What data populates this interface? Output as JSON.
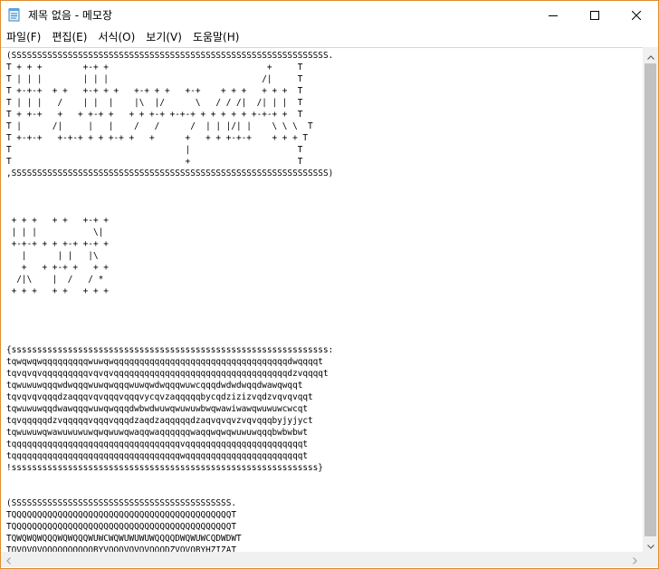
{
  "window": {
    "title": "제목 없음 - 메모장",
    "icon": "notepad-icon"
  },
  "caption_buttons": {
    "minimize": "minimize-icon",
    "maximize": "maximize-icon",
    "close": "close-icon"
  },
  "menu": [
    {
      "label": "파일(F)"
    },
    {
      "label": "편집(E)"
    },
    {
      "label": "서식(O)"
    },
    {
      "label": "보기(V)"
    },
    {
      "label": "도움말(H)"
    }
  ],
  "editor": {
    "content": "(SSSSSSSSSSSSSSSSSSSSSSSSSSSSSSSSSSSSSSSSSSSSSSSSSSSSSSSSSSSSSS.\nT + + +        +-+ +                               +     T\nT | | |        | | |                              /|     T\nT +-+-+  + +   +-+ + +   +-+ + +   +-+    + + +   + + +  T\nT | | |   /    | |  |    |\\  |/      \\   / / /|  /| | |  T\nT + +-+   +   + +-+ +   + + +-+ +-+-+ + + + + + +-+-+ +  T\nT |      /|     |   |    /   /      /  | | |/| |    \\ \\ \\  T\nT +-+-+   +-+-+ + + +-+ +   +      +   + + +-+-+    + + + T\nT                                  |                     T\nT                                  +                     T\n,SSSSSSSSSSSSSSSSSSSSSSSSSSSSSSSSSSSSSSSSSSSSSSSSSSSSSSSSSSSSSS)\n\n\n\n + + +   + +   +-+ +\n | | |           \\|\n +-+-+ + + +-+ +-+ +\n   |      | |   |\\\n   +   + +-+ +   + +\n  /|\\    |  /   / *\n + + +   + +   + + +\n\n\n\n\n{ssssssssssssssssssssssssssssssssssssssssssssssssssssssssssssss:\ntqwqwqwqqqqqqqqqwuwqwqqqqqqqqqqqqqqqqqqqqqqqqqqqqqqqqqqdwqqqqt\ntqvqvqvqqqqqqqqqvqvqvqqqqqqqqqqqqqqqqqqqqqqqqqqqqqqqqqqdzvqqqqt\ntqwuwuwqqqwdwqqqwuwqwqqqwuwqwdwqqqwuwcqqqdwdwdwqqdwawqwqqt\ntqvqvqvqqqdzaqqqvqvqqqvqqqvycqvzaqqqqqbycqdzizizvqdzvqvqvqqt\ntqwuwuwqqdwawqqqwuwqwqqqdwbwdwuwqwuwuwbwqwawiwawqwuwuwcwcqt\ntqvqqqqqdzvqqqqqvqqqvqqqdzaqdzaqqqqqdzaqvqvqvzvqvqqqbyjyjyct\ntqwuwuwqwawuwuwuwqwqwuwqwaqqwaqqqqqqwaqqwqwqwuwuwqqqbwbwbwt\ntqqqqqqqqqqqqqqqqqqqqqqqqqqqqqqqqqvqqqqqqqqqqqqqqqqqqqqqqqt\ntqqqqqqqqqqqqqqqqqqqqqqqqqqqqqqqqqwqqqqqqqqqqqqqqqqqqqqqqqt\n!ssssssssssssssssssssssssssssssssssssssssssssssssssssssssssss}\n\n\n(SSSSSSSSSSSSSSSSSSSSSSSSSSSSSSSSSSSSSSSSSSS.\nTQQQQQQQQQQQQQQQQQQQQQQQQQQQQQQQQQQQQQQQQQQQT\nTQQQQQQQQQQQQQQQQQQQQQQQQQQQQQQQQQQQQQQQQQQQT\nTQWQWQWQQQWQWQQQWUWCWQWUWUWUWQQQQDWQWUWCQDWDWT\nTQVQVQVQQQQQQQQQQBYVQQQVQVQVQQQDZVQVQBYHZIZAT\nTQWUWUWQWQWQWUWQWUWJWQQDWUWUWQWQWIWQWUWUWUWEQT"
  }
}
